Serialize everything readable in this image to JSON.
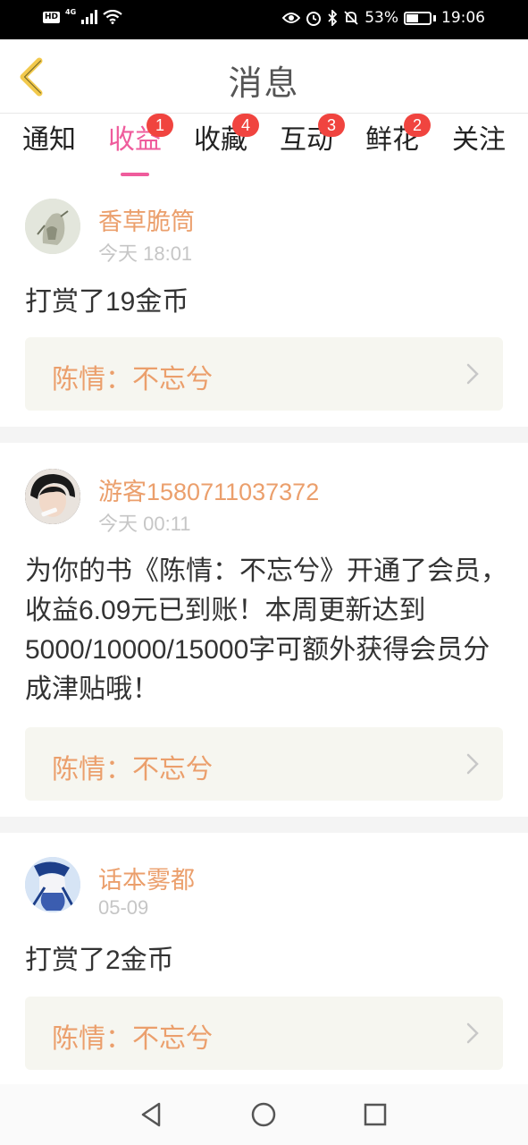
{
  "status_bar": {
    "hd": "HD",
    "network": "4G",
    "battery": "53%",
    "battery_level": 0.53,
    "time": "19:06"
  },
  "header": {
    "title": "消息"
  },
  "tabs": [
    {
      "label": "通知",
      "badge": "",
      "active": false
    },
    {
      "label": "收益",
      "badge": "1",
      "active": true
    },
    {
      "label": "收藏",
      "badge": "4",
      "active": false
    },
    {
      "label": "互动",
      "badge": "3",
      "active": false
    },
    {
      "label": "鲜花",
      "badge": "2",
      "active": false
    },
    {
      "label": "关注",
      "badge": "",
      "active": false
    }
  ],
  "messages": [
    {
      "username": "香草脆筒",
      "time": "今天 18:01",
      "text": "打赏了19金币",
      "book": "陈情：不忘兮"
    },
    {
      "username": "游客1580711037372",
      "time": "今天 00:11",
      "text": "为你的书《陈情：不忘兮》开通了会员，收益6.09元已到账！本周更新达到5000/10000/15000字可额外获得会员分成津贴哦！",
      "book": "陈情：不忘兮"
    },
    {
      "username": "话本雾都",
      "time": "05-09",
      "text": "打赏了2金币",
      "book": "陈情：不忘兮"
    }
  ],
  "colors": {
    "accent": "#ef5c9c",
    "username": "#eb9f6c",
    "badge": "#f0443f",
    "back_arrow": "#f2c94c"
  }
}
